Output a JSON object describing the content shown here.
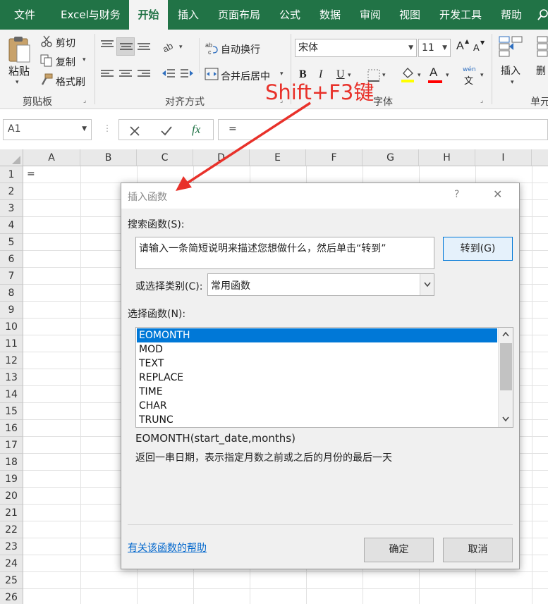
{
  "ribbon_tabs": [
    "文件",
    "Excel与财务",
    "开始",
    "插入",
    "页面布局",
    "公式",
    "数据",
    "审阅",
    "视图",
    "开发工具",
    "帮助"
  ],
  "active_tab": "开始",
  "clipboard": {
    "paste": "粘贴",
    "cut": "剪切",
    "copy": "复制",
    "format_painter": "格式刷",
    "group_label": "剪贴板"
  },
  "alignment": {
    "wrap_text": "自动换行",
    "merge_center": "合并后居中",
    "group_label": "对齐方式"
  },
  "font": {
    "name": "宋体",
    "size": "11",
    "bold": "B",
    "italic": "I",
    "underline": "U",
    "color_glyph": "A",
    "size_up": "A",
    "size_down": "A",
    "group_label": "字体",
    "phonetic_top": "wén",
    "phonetic_bottom": "文"
  },
  "cells": {
    "insert": "插入",
    "delete": "删",
    "group_label": "单元"
  },
  "formula_bar": {
    "name_box": "A1",
    "fx": "fx",
    "content": "="
  },
  "columns": [
    "A",
    "B",
    "C",
    "D",
    "E",
    "F",
    "G",
    "H",
    "I"
  ],
  "rows": [
    "1",
    "2",
    "3",
    "4",
    "5",
    "6",
    "7",
    "8",
    "9",
    "10",
    "11",
    "12",
    "13",
    "14",
    "15",
    "16",
    "17",
    "18",
    "19",
    "20",
    "21",
    "22",
    "23",
    "24",
    "25",
    "26"
  ],
  "cell_a1": "=",
  "dialog": {
    "title": "插入函数",
    "help": "?",
    "close": "✕",
    "search_label": "搜索函数(S):",
    "search_placeholder": "请输入一条简短说明来描述您想做什么，然后单击“转到”",
    "go_button": "转到(G)",
    "category_label": "或选择类别(C):",
    "category_value": "常用函数",
    "function_label": "选择函数(N):",
    "functions": [
      "EOMONTH",
      "MOD",
      "TEXT",
      "REPLACE",
      "TIME",
      "CHAR",
      "TRUNC"
    ],
    "selected_function": "EOMONTH",
    "signature": "EOMONTH(start_date,months)",
    "description": "返回一串日期，表示指定月数之前或之后的月份的最后一天",
    "help_link": "有关该函数的帮助",
    "ok": "确定",
    "cancel": "取消"
  },
  "annotation": "Shift+F3键",
  "colors": {
    "excel_green": "#217346",
    "accent_blue": "#0078d7",
    "annotation_red": "#e8312a"
  }
}
